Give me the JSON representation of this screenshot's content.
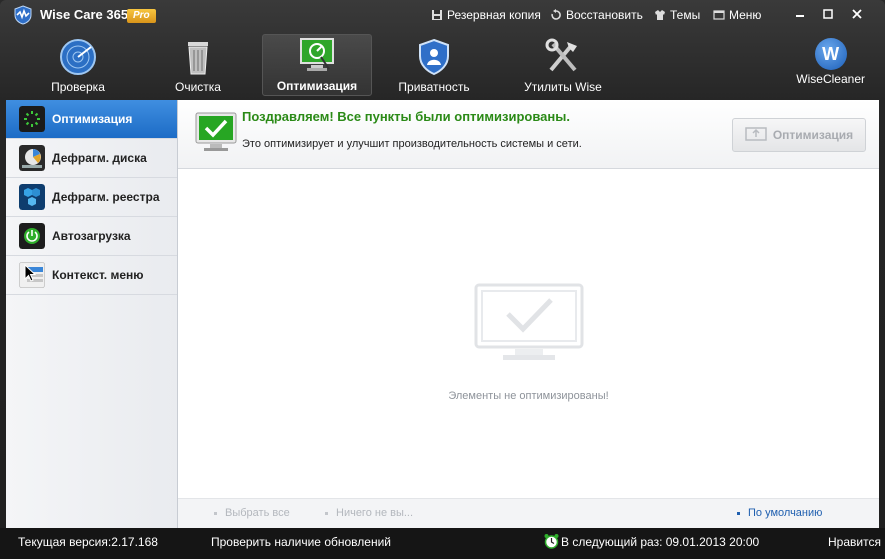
{
  "app": {
    "title": "Wise Care 365",
    "badge": "Pro"
  },
  "title_menu": {
    "backup": "Резервная копия",
    "restore": "Восстановить",
    "themes": "Темы",
    "menu": "Меню"
  },
  "toolbar": {
    "items": [
      {
        "label": "Проверка",
        "icon": "radar-icon"
      },
      {
        "label": "Очистка",
        "icon": "trash-icon"
      },
      {
        "label": "Оптимизация",
        "icon": "optimize-monitor-icon",
        "active": true
      },
      {
        "label": "Приватность",
        "icon": "shield-icon"
      },
      {
        "label": "Утилиты Wise",
        "icon": "tools-icon"
      }
    ],
    "brand": "WiseCleaner",
    "brand_letter": "W"
  },
  "sidebar": {
    "items": [
      {
        "label": "Оптимизация",
        "icon": "optimize-icon",
        "active": true
      },
      {
        "label": "Дефрагм. диска",
        "icon": "disk-defrag-icon"
      },
      {
        "label": "Дефрагм. реестра",
        "icon": "registry-defrag-icon"
      },
      {
        "label": "Автозагрузка",
        "icon": "startup-icon"
      },
      {
        "label": "Контекст. меню",
        "icon": "context-menu-icon"
      }
    ]
  },
  "banner": {
    "title": "Поздравляем! Все пункты были оптимизированы.",
    "subtitle": "Это оптимизирует и улучшит производительность системы и сети.",
    "button": "Оптимизация"
  },
  "empty": {
    "text": "Элементы не оптимизированы!"
  },
  "listbar": {
    "select_all": "Выбрать все",
    "select_none": "Ничего не вы...",
    "default": "По умолчанию"
  },
  "status": {
    "version": "Текущая версия:2.17.168",
    "check_updates": "Проверить наличие обновлений",
    "next_run": "В следующий раз: 09.01.2013 20:00",
    "like": "Нравится"
  },
  "colors": {
    "accent_blue": "#1d6cc6",
    "success_green": "#2b8a17",
    "pro_badge": "#e3a52a",
    "link_blue": "#2060b0"
  }
}
